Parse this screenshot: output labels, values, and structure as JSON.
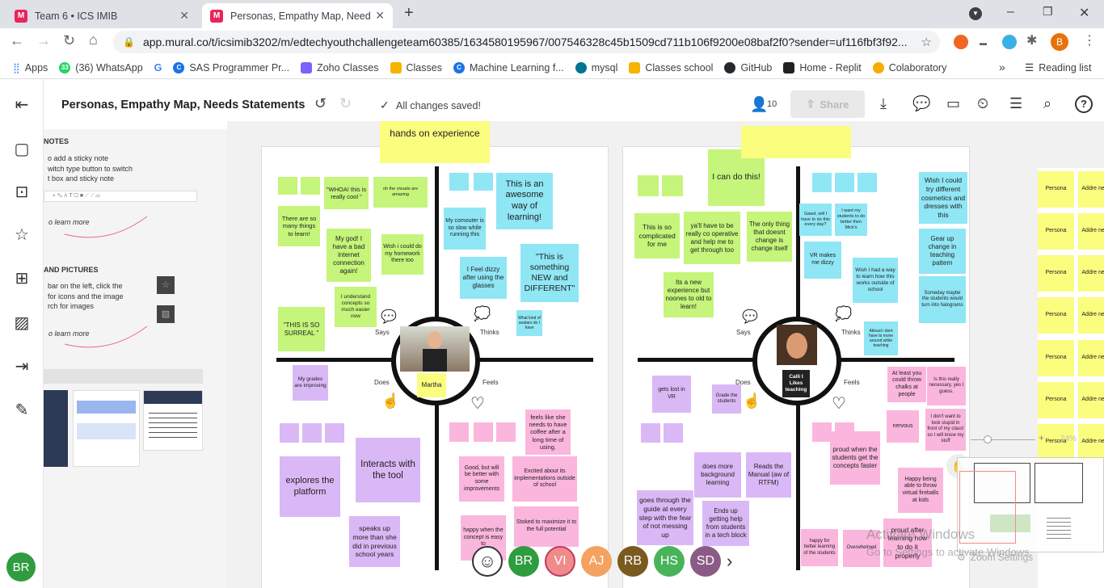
{
  "browser": {
    "tabs": [
      {
        "title": "Team 6 • ICS IMIB"
      },
      {
        "title": "Personas, Empathy Map, Needs S"
      }
    ],
    "url": "app.mural.co/t/icsimib3202/m/edtechyouthchallengeteam60385/1634580195967/007546328c45b1509cd711b106f9200e08baf2f0?sender=uf116fbf3f92...",
    "profile_initial": "B",
    "bookmarks": [
      "Apps",
      "(36) WhatsApp",
      "SAS Programmer Pr...",
      "Zoho Classes",
      "Classes",
      "Machine Learning f...",
      "mysql",
      "Classes school",
      "GitHub",
      "Home - Replit",
      "Colaboratory"
    ],
    "whatsapp_badge": "33",
    "reading_list": "Reading list"
  },
  "mural": {
    "title": "Personas, Empathy Map, Needs Statements",
    "save_status": "All changes saved!",
    "participants": "10",
    "share_label": "Share",
    "user_initials": "BR",
    "panel": {
      "notes_heading": "NOTES",
      "notes_lines": [
        "o add a sticky note",
        "witch type button to switch",
        "t box and sticky note"
      ],
      "learn_more": "o learn more",
      "pictures_heading": "AND PICTURES",
      "pictures_lines": [
        "bar on the left, click the",
        "for icons and the image",
        "rch for images"
      ],
      "learn_more2": "o learn more"
    },
    "board1": {
      "top_note": "hands on experience",
      "labels": {
        "says": "Says",
        "thinks": "Thinks",
        "does": "Does",
        "feels": "Feels"
      },
      "persona_name": "Martha",
      "says": [
        "\"WHOA! this is really cool \"",
        "oh the visuals are amazing",
        "There are so many things to learn!",
        "My god! I have a bad internet connection again!",
        "Wish i could do my homework there too",
        "\"THIS IS SO SURREAL \"",
        "I understand concepts so much easier now"
      ],
      "thinks": [
        "This is an awesome way of learning!",
        "My comouter is so slow while running this",
        "I Feel dizzy after using the glasses",
        "\"This is something NEW and DIFFERENT\"",
        "What kind of avatars do I have"
      ],
      "does": [
        "My grades are improving",
        "explores the platform",
        "Interacts with the tool",
        "speaks up more than she did in previous school years"
      ],
      "feels": [
        "feels like she needs to have coffee after a long time of using.",
        "Good, but will be better with some improvements",
        "Excited about its implementations outside of school",
        "happy when the concept is easy to",
        "Stoked to maximize it to the full potential"
      ]
    },
    "board2": {
      "top_note": "",
      "labels": {
        "says": "Says",
        "thinks": "Thinks",
        "does": "Does",
        "feels": "Feels"
      },
      "persona_name": "Calli I Likes teaching",
      "says": [
        "I can do this!",
        "This is so complicated for me",
        "ya'll have to be really co operative and help me to get through too",
        "The only thing that doesnt change is change itself",
        "Its a new experience but noones to old to learn!"
      ],
      "thinks": [
        "Wish I could try different cosmetics and dresses with this",
        "Gawd, will I have to do this every day?",
        "I want my students to do better then Mick's",
        "Gear up change in teaching pattern",
        "VR makes me dizzy",
        "Wish I had a way to learn how this works outside of school",
        "Someday maybe the students would turn into halograms",
        "Atleast i dont have to move around while teaching"
      ],
      "does": [
        "gets lost in VR",
        "Grade the students",
        "does more background learning",
        "Reads the Manual (aw of RTFM)",
        "goes through the guide at every step with the fear of not messing up",
        "Ends up getting help from students in a tech block"
      ],
      "feels": [
        "At least you could throw chalks at people",
        "Is this really necessary, yes I guess.",
        "nervous",
        "I don't want to look stupid in front of my class! so I will know my stuff",
        "proud when the students get the concepts faster",
        "Happy being able to throw virtual fireballs at kids",
        "happy for better learning of the students",
        "Overwhelmed",
        "proud after learning how to do it properly"
      ]
    },
    "right_column": {
      "persona_label": "Persona",
      "address_label": "Addre need"
    },
    "bottom_avatars": [
      {
        "initials": "BR",
        "color": "#2e9c3f"
      },
      {
        "initials": "VI",
        "color": "#f08b8b"
      },
      {
        "initials": "AJ",
        "color": "#f4a261"
      },
      {
        "initials": "RB",
        "color": "#7a5a1e"
      },
      {
        "initials": "HS",
        "color": "#49b35a"
      },
      {
        "initials": "SD",
        "color": "#8b5b87"
      }
    ],
    "zoom": {
      "percent": "24%",
      "settings_label": "Zoom Settings"
    },
    "watermark": {
      "line1": "Activate Windows",
      "line2": "Go to Settings to activate Windows."
    }
  }
}
